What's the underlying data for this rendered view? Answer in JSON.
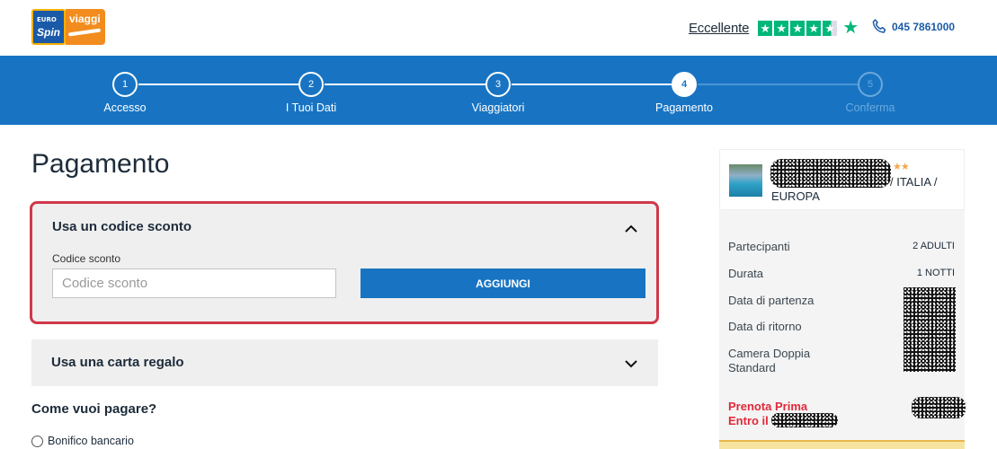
{
  "logo": {
    "euro": "EURO",
    "spin": "Spin",
    "viaggi": "viaggi"
  },
  "header": {
    "trust_label": "Eccellente",
    "phone": "045 7861000"
  },
  "stepper": [
    {
      "num": "1",
      "label": "Accesso",
      "state": "done"
    },
    {
      "num": "2",
      "label": "I Tuoi Dati",
      "state": "done"
    },
    {
      "num": "3",
      "label": "Viaggiatori",
      "state": "done"
    },
    {
      "num": "4",
      "label": "Pagamento",
      "state": "active"
    },
    {
      "num": "5",
      "label": "Conferma",
      "state": "disabled"
    }
  ],
  "main": {
    "title": "Pagamento",
    "discount": {
      "title": "Usa un codice sconto",
      "field_label": "Codice sconto",
      "placeholder": "Codice sconto",
      "value": "",
      "button": "AGGIUNGI"
    },
    "gift_card": {
      "title": "Usa una carta regalo"
    },
    "payment": {
      "title": "Come vuoi pagare?",
      "options": [
        "Bonifico bancario"
      ]
    }
  },
  "sidebar": {
    "stars": "★★",
    "location_line1": "/ ITALIA /",
    "location_line2": "EUROPA",
    "rows": [
      {
        "label": "Partecipanti",
        "value": "2 ADULTI"
      },
      {
        "label": "Durata",
        "value": "1 NOTTI"
      },
      {
        "label": "Data di partenza",
        "value": ""
      },
      {
        "label": "Data di ritorno",
        "value": ""
      },
      {
        "label": "Camera Doppia Standard",
        "value": ""
      }
    ],
    "promo_line1": "Prenota Prima",
    "promo_line2": "Entro il"
  },
  "colors": {
    "brand_blue": "#1874c3",
    "highlight_red": "#d0384a",
    "trustpilot_green": "#00b67a",
    "promo_red": "#e0293a"
  }
}
